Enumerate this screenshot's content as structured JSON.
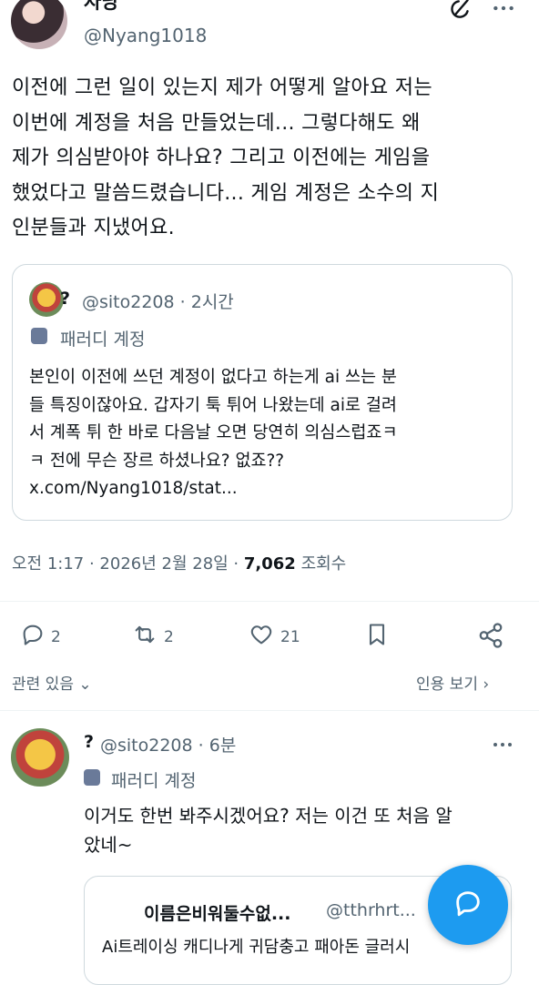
{
  "tweet": {
    "display_name": "자낭",
    "handle": "@Nyang1018",
    "text": "이전에 그런 일이 있는지 제가 어떻게 알아요 저는\n이번에 계정을 처음 만들었는데... 그렇다해도 왜\n제가 의심받아야 하나요? 그리고 이전에는 게임을\n했었다고 말씀드렸습니다... 게임 계정은 소수의 지\n인분들과 지냈어요.",
    "quote": {
      "name": "?",
      "handle_time": "@sito2208 · 2시간",
      "parody_label": "패러디 계정",
      "text": "본인이 이전에 쓰던 계정이 없다고 하는게 ai 쓰는 분\n들 특징이잖아요. 갑자기 툭 튀어 나왔는데 ai로 걸려\n서 계폭 튀 한 바로 다음날 오면 당연히 의심스럽죠ㅋ\nㅋ 전에 무슨 장르 하셨나요? 없죠??\nx.com/Nyang1018/stat..."
    },
    "timestamp": "오전 1:17 · 2026년 2월 28일 · ",
    "views_count": "7,062",
    "views_label": "조회수",
    "actions": {
      "replies": "2",
      "retweets": "2",
      "likes": "21"
    },
    "related_label": "관련 있음",
    "quotes_label": "인용 보기"
  },
  "reply": {
    "name": "?",
    "handle_time": "@sito2208 · 6분",
    "parody_label": "패러디 계정",
    "text": "이거도 한번 봐주시겠어요? 저는 이건 또 처음 알\n았네~",
    "quote": {
      "name": "이름은비워둘수없...",
      "handle": "@tthrhrt...",
      "text": "Ai트레이싱 캐디나게 귀담충고 패아돈 글러시"
    }
  },
  "icons": {
    "grok": "grok-icon",
    "more": "more-icon",
    "reply": "reply-icon",
    "retweet": "retweet-icon",
    "like": "heart-icon",
    "bookmark": "bookmark-icon",
    "share": "share-icon",
    "compose": "compose-icon"
  },
  "colors": {
    "accent": "#1d9bf0",
    "text": "#0f1419",
    "muted": "#536471",
    "border": "#cfd9de"
  }
}
